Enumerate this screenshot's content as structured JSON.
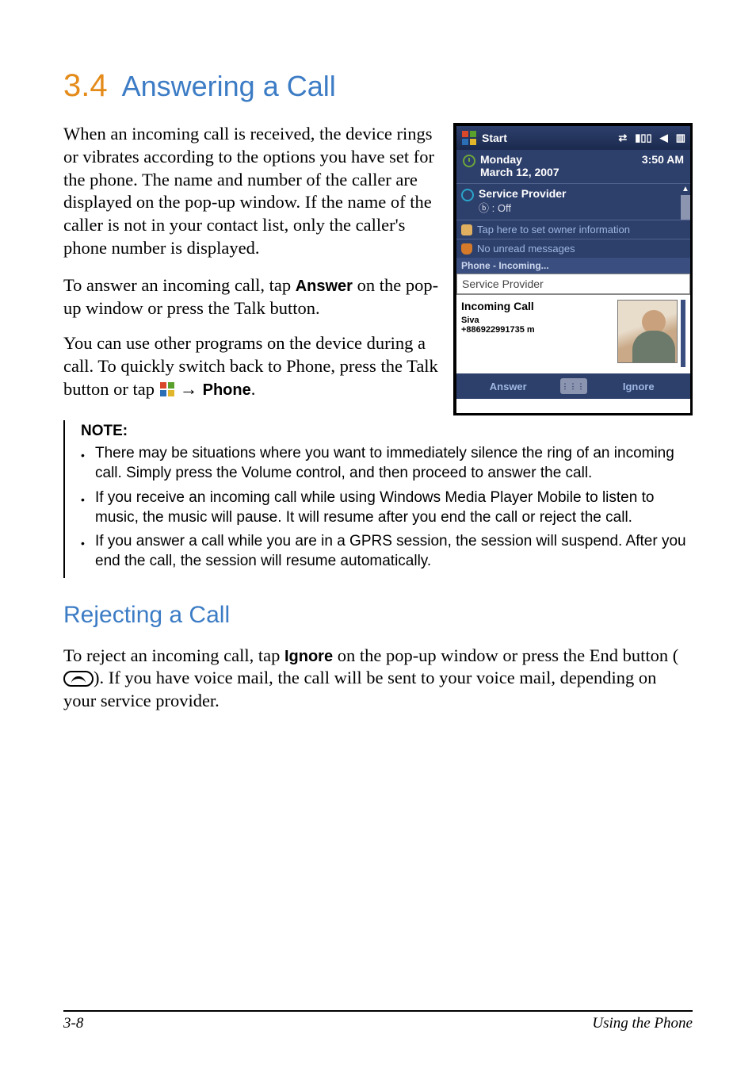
{
  "heading": {
    "number": "3.4",
    "title": "Answering a Call"
  },
  "p1": "When an incoming call is received, the device rings or vibrates according to the options you have set for the phone. The name and number of the caller are displayed on the pop-up window. If the name of the caller is not in your contact list, only the caller's phone number is displayed.",
  "p2a": "To answer an incoming call, tap ",
  "p2b": "Answer",
  "p2c": " on the pop-up window or press the Talk button.",
  "p3a": "You can use other programs on the device during a call. To quickly switch back to Phone, press the Talk button or tap ",
  "p3b": " → ",
  "p3c": "Phone",
  "p3d": ".",
  "note": {
    "label": "NOTE:",
    "items": [
      "There may be situations where you want to immediately silence the ring of an incoming call. Simply press the Volume control, and then proceed to answer the call.",
      "If you receive an incoming call while using Windows Media Player Mobile to listen to music, the music will pause. It will resume after you end the call or reject the call.",
      "If you answer a call while you are in a GPRS session, the session will suspend. After you end the call, the session will resume automatically."
    ]
  },
  "subhead": "Rejecting a Call",
  "rej_a": "To reject an incoming call, tap ",
  "rej_b": "Ignore",
  "rej_c": " on the pop-up window or press the End button (",
  "rej_d": "). If you have voice mail, the call will be sent to your voice mail, depending on your service provider.",
  "footer": {
    "page": "3-8",
    "chapter": "Using the Phone"
  },
  "shot": {
    "start": "Start",
    "day": "Monday",
    "date": "March 12, 2007",
    "time": "3:50 AM",
    "sp": "Service Provider",
    "bt": "ⓑ : Off",
    "owner": "Tap here to set owner information",
    "unread": "No unread messages",
    "phone_inc": "Phone - Incoming...",
    "sp2": "Service Provider",
    "inc": "Incoming Call",
    "name": "Siva",
    "number": "+886922991735 m",
    "answer": "Answer",
    "ignore": "Ignore"
  }
}
